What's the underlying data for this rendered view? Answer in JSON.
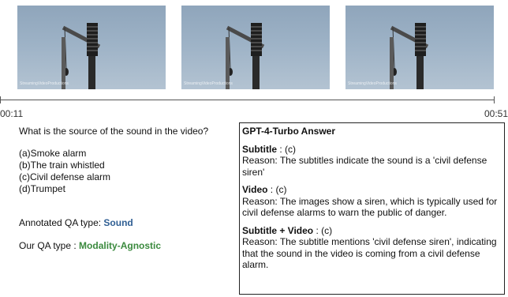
{
  "frames": [
    {
      "watermark": "StreamingVideoProductions"
    },
    {
      "watermark": "StreamingVideoProductions"
    },
    {
      "watermark": "StreamingVideoProductions"
    }
  ],
  "timeline": {
    "start": "00:11",
    "end": "00:51"
  },
  "question": "What is the source of the sound in the video?",
  "options": [
    "(a)Smoke alarm",
    "(b)The train whistled",
    "(c)Civil defense alarm",
    "(d)Trumpet"
  ],
  "annotated": {
    "label": "Annotated QA type: ",
    "value": "Sound",
    "color": "#2f5e93"
  },
  "our": {
    "label": "Our QA type : ",
    "value": "Modality-Agnostic",
    "color": "#3b8a3e"
  },
  "answer": {
    "title": "GPT-4-Turbo Answer",
    "sections": [
      {
        "label": "Subtitle",
        "choice": " : (c)",
        "reason": "Reason: The subtitles indicate the sound is a 'civil defense siren'"
      },
      {
        "label": "Video",
        "choice": " : (c)",
        "reason": "Reason: The images show a siren, which is typically used for civil defense alarms to warn the public of danger."
      },
      {
        "label": "Subtitle + Video",
        "choice": " : (c)",
        "reason": "Reason: The subtitle mentions 'civil defense siren', indicating that the sound in the video is coming from a civil defense alarm."
      }
    ]
  }
}
